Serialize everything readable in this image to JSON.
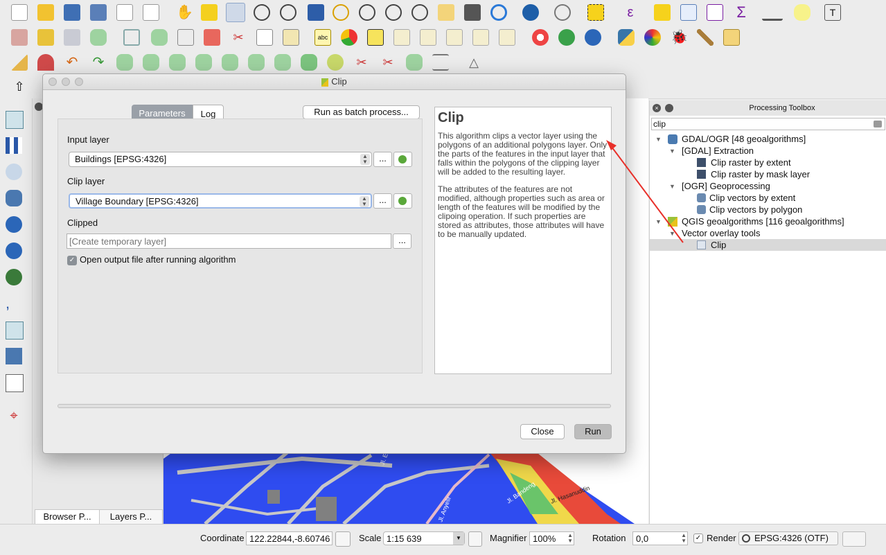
{
  "dialog": {
    "title": "Clip",
    "tabs": {
      "parameters": "Parameters",
      "log": "Log"
    },
    "batch_button": "Run as batch process...",
    "input_layer_label": "Input layer",
    "input_layer_value": "Buildings [EPSG:4326]",
    "clip_layer_label": "Clip layer",
    "clip_layer_value": "Village Boundary [EPSG:4326]",
    "clipped_label": "Clipped",
    "clipped_placeholder": "[Create temporary layer]",
    "browse_label": "...",
    "open_output_label": "Open output file after running algorithm",
    "open_output_checked": true,
    "close_button": "Close",
    "run_button": "Run",
    "help_title": "Clip",
    "help_p1": "This algorithm clips a vector layer using the polygons of an additional polygons layer. Only the parts of the features in the input layer that falls within the polygons of the clipping layer will be added to the resulting layer.",
    "help_p2": "The attributes of the features are not modified, although properties such as area or length of the features will be modified by the clipoing operation. If such properties are stored as attributes, those attributes will have to be manually updated."
  },
  "toolbox": {
    "title": "Processing Toolbox",
    "search_value": "clip",
    "tree": [
      {
        "label": "GDAL/OGR [48 geoalgorithms]",
        "level": 0
      },
      {
        "label": "[GDAL] Extraction",
        "level": 1
      },
      {
        "label": "Clip raster by extent",
        "level": 2
      },
      {
        "label": "Clip raster by mask layer",
        "level": 2
      },
      {
        "label": "[OGR] Geoprocessing",
        "level": 1
      },
      {
        "label": "Clip vectors by extent",
        "level": 2
      },
      {
        "label": "Clip vectors by polygon",
        "level": 2
      },
      {
        "label": "QGIS geoalgorithms [116 geoalgorithms]",
        "level": 0
      },
      {
        "label": "Vector overlay tools",
        "level": 1
      },
      {
        "label": "Clip",
        "level": 2
      }
    ]
  },
  "panels": {
    "browser_tab": "Browser P...",
    "layers_tab": "Layers P..."
  },
  "map_labels": [
    "Jl. El Tari",
    "Jl. Bandeng",
    "Jl. Hasanuddin",
    "Jl. Anyelir"
  ],
  "status": {
    "coordinate_label": "Coordinate",
    "coordinate_value": "122.22844,-8.60746",
    "scale_label": "Scale",
    "scale_value": "1:15 639",
    "magnifier_label": "Magnifier",
    "magnifier_value": "100%",
    "rotation_label": "Rotation",
    "rotation_value": "0,0",
    "render_label": "Render",
    "render_checked": true,
    "crs_value": "EPSG:4326 (OTF)"
  },
  "colors": {
    "map_blue": "#2f4cf0",
    "annotation_arrow": "#e8302a",
    "selected_row": "#d9d9d9"
  }
}
